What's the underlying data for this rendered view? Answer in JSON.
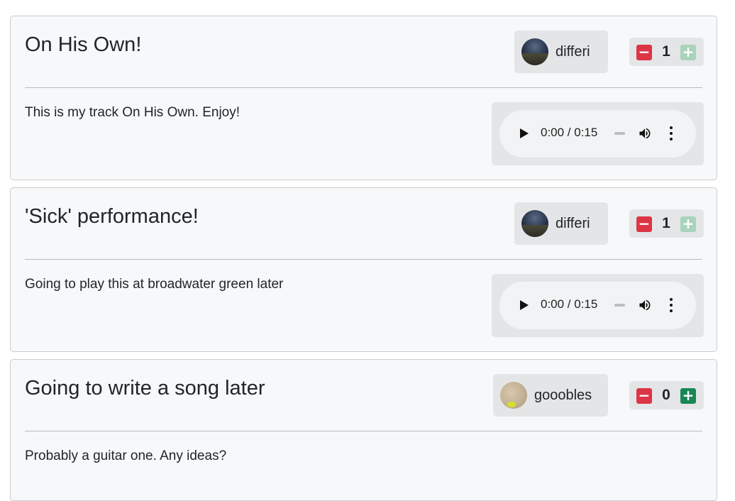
{
  "posts": [
    {
      "title": "On His Own!",
      "author": "differi",
      "author_avatar": "night-sky-avatar",
      "votes": "1",
      "upvote_enabled": false,
      "body": "This is my track On His Own. Enjoy!",
      "audio": {
        "time": "0:00 / 0:15"
      }
    },
    {
      "title": "'Sick' performance!",
      "author": "differi",
      "author_avatar": "night-sky-avatar",
      "votes": "1",
      "upvote_enabled": false,
      "body": "Going to play this at broadwater green later",
      "audio": {
        "time": "0:00 / 0:15"
      }
    },
    {
      "title": "Going to write a song later",
      "author": "gooobles",
      "author_avatar": "sand-avatar",
      "votes": "0",
      "upvote_enabled": true,
      "body": "Probably a guitar one. Any ideas?"
    }
  ],
  "icons": {
    "downvote": "minus-icon",
    "upvote": "plus-icon",
    "play": "play-icon",
    "volume": "volume-icon",
    "more": "more-options-icon"
  },
  "colors": {
    "downvote": "#dc3545",
    "upvote": "#198754",
    "upvote_disabled": "#a9d3bc",
    "card_bg": "#f7f8fa",
    "chip_bg": "#e4e5e7"
  }
}
